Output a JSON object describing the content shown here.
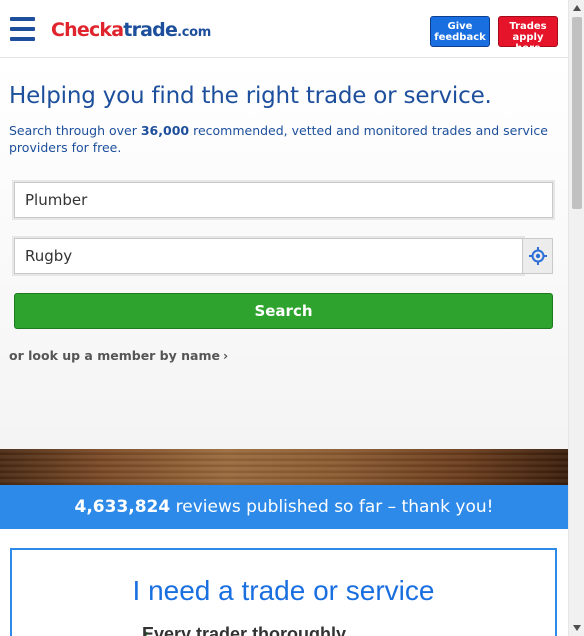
{
  "header": {
    "logo": {
      "part1": "Check",
      "part2": "a",
      "part3": "trade",
      "part4": ".com"
    },
    "feedback_button": {
      "line1": "Give",
      "line2": "feedback"
    },
    "trades_button": {
      "line1": "Trades",
      "line2": "apply here"
    }
  },
  "hero": {
    "headline": "Helping you find the right trade or service.",
    "subtext_before": "Search through over ",
    "subtext_count": "36,000",
    "subtext_after": " recommended, vetted and monitored trades and service providers for free.",
    "trade_input": {
      "value": "Plumber"
    },
    "location_input": {
      "value": "Rugby"
    },
    "search_label": "Search",
    "lookup_label": "or look up a member by name"
  },
  "reviews": {
    "count": "4,633,824",
    "text": " reviews published so far – thank you!"
  },
  "card": {
    "title": "I need a trade or service",
    "item": "Every trader thoroughly"
  },
  "icons": {
    "menu": "hamburger-menu-icon",
    "locate": "crosshair-locate-icon",
    "chevron": "chevron-right-icon",
    "check": "checkmark-icon"
  },
  "colors": {
    "brand_blue": "#1d4f9c",
    "brand_red": "#e0242d",
    "search_green": "#2ea32e",
    "band_blue": "#2d8ae8"
  }
}
